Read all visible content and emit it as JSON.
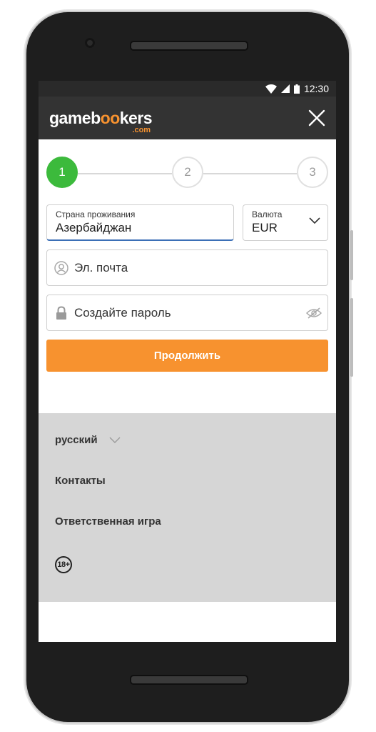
{
  "statusbar": {
    "time": "12:30"
  },
  "header": {
    "logo_main": "gameb",
    "logo_oo": "oo",
    "logo_end": "kers",
    "logo_com": ".com",
    "close_icon": "close-icon"
  },
  "stepper": {
    "steps": [
      "1",
      "2",
      "3"
    ],
    "active": 1
  },
  "form": {
    "country": {
      "label": "Страна проживания",
      "value": "Азербайджан"
    },
    "currency": {
      "label": "Валюта",
      "value": "EUR"
    },
    "email": {
      "placeholder": "Эл. почта",
      "icon": "user-icon"
    },
    "password": {
      "placeholder": "Создайте пароль",
      "icon": "lock-icon",
      "toggle_icon": "eye-off-icon"
    },
    "continue_label": "Продолжить"
  },
  "footer": {
    "language": "русский",
    "contacts": "Контакты",
    "responsible": "Ответственная игра",
    "age": "18+"
  },
  "colors": {
    "accent": "#f7922f",
    "step_active": "#3cba3c",
    "appbar": "#333333",
    "footer_bg": "#d6d6d6",
    "focus": "#3b6fb6"
  }
}
